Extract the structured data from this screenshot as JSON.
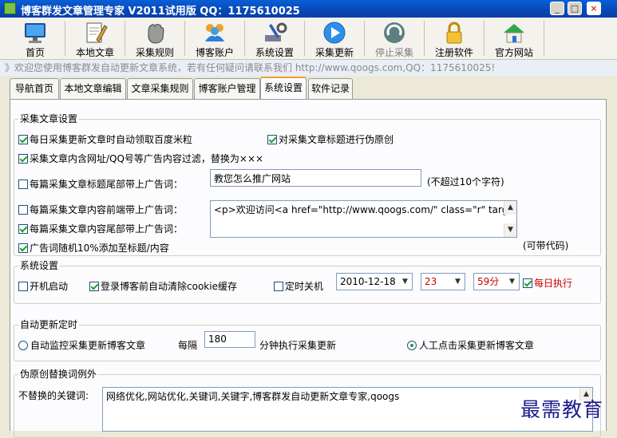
{
  "window": {
    "title": "博客群发文章管理专家 V2011试用版 QQ：1175610025",
    "controls": {
      "minimize": "_",
      "maximize": "□",
      "close": "×"
    }
  },
  "toolbar": {
    "items": [
      {
        "label": "首页",
        "icon": "monitor-icon"
      },
      {
        "label": "本地文章",
        "icon": "document-pen-icon"
      },
      {
        "label": "采集规则",
        "icon": "hand-grab-icon"
      },
      {
        "label": "博客账户",
        "icon": "users-icon"
      },
      {
        "label": "系统设置",
        "icon": "tools-icon"
      },
      {
        "label": "采集更新",
        "icon": "play-icon"
      },
      {
        "label": "停止采集",
        "icon": "stop-refresh-icon"
      },
      {
        "label": "注册软件",
        "icon": "lock-icon"
      },
      {
        "label": "官方网站",
        "icon": "home-icon"
      }
    ]
  },
  "marquee": "》欢迎您使用博客群发自动更新文章系统，若有任何疑问请联系我们 http://www.qoogs.com,QQ：1175610025!",
  "tabs": [
    {
      "label": "导航首页"
    },
    {
      "label": "本地文章编辑"
    },
    {
      "label": "文章采集规则"
    },
    {
      "label": "博客账户管理"
    },
    {
      "label": "系统设置"
    },
    {
      "label": "软件记录"
    }
  ],
  "collect": {
    "title": "采集文章设置",
    "daily_baidu": "每日采集更新文章时自动领取百度米粒",
    "pseudo_title": "对采集文章标题进行伪原创",
    "filter_ads": "采集文章内含网址/QQ号等广告内容过滤，替换为×××",
    "title_tail_ad": "每篇采集文章标题尾部带上广告词：",
    "title_ad_value": "教您怎么推广网站",
    "title_ad_hint": "(不超过10个字符)",
    "content_head_ad": "每篇采集文章内容前端带上广告词：",
    "content_tail_ad": "每篇采集文章内容尾部带上广告词：",
    "content_ad_value": "<p>欢迎访问<a href=\"http://www.qoogs.com/\"  class=\"r\" target=\"_blank\">",
    "random_ad": "广告词随机10%添加至标题/内容",
    "code_hint": "(可带代码)"
  },
  "system": {
    "title": "系统设置",
    "autostart": "开机启动",
    "clear_cookie": "登录博客前自动清除cookie缓存",
    "shutdown": "定时关机",
    "date": "2010-12-18",
    "hour": "23",
    "minute": "59分",
    "daily": "每日执行"
  },
  "schedule": {
    "title": "自动更新定时",
    "auto_monitor": "自动监控采集更新博客文章",
    "every": "每隔",
    "interval": "180",
    "interval_suffix": "分钟执行采集更新",
    "manual": "人工点击采集更新博客文章"
  },
  "exceptions": {
    "title": "伪原创替换词例外",
    "label": "不替换的关键词:",
    "value": "网络优化,网站优化,关键词,关键字,博客群发自动更新文章专家,qoogs"
  },
  "watermark": "最需教育",
  "colors": {
    "titlebar": "#0847b8",
    "accent_red": "#cc0000",
    "check_green": "#21a121"
  }
}
